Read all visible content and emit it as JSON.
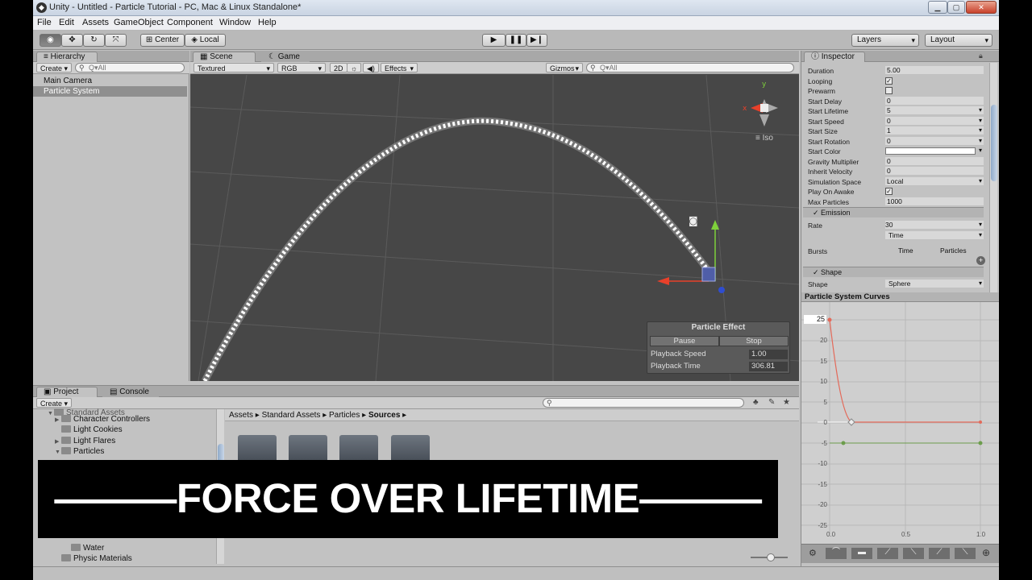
{
  "window": {
    "title": "Unity - Untitled - Particle Tutorial - PC, Mac & Linux Standalone*"
  },
  "menu": [
    "File",
    "Edit",
    "Assets",
    "GameObject",
    "Component",
    "Window",
    "Help"
  ],
  "toolbar": {
    "pivot": "Center",
    "space": "Local",
    "layers": "Layers",
    "layout": "Layout"
  },
  "hierarchy": {
    "tab": "Hierarchy",
    "create": "Create",
    "search": "Q▾All",
    "items": [
      "Main Camera",
      "Particle System"
    ]
  },
  "scene": {
    "tabs": [
      "Scene",
      "Game"
    ],
    "render_mode": "Textured",
    "color_mode": "RGB",
    "mode_2d": "2D",
    "effects": "Effects",
    "gizmos": "Gizmos",
    "search": "Q▾All",
    "projection": "Iso",
    "particle_effect": {
      "title": "Particle Effect",
      "pause": "Pause",
      "stop": "Stop",
      "speed_label": "Playback Speed",
      "speed_value": "1.00",
      "time_label": "Playback Time",
      "time_value": "306.81"
    }
  },
  "inspector": {
    "tab": "Inspector",
    "props": [
      {
        "label": "Duration",
        "value": "5.00"
      },
      {
        "label": "Looping",
        "check": true
      },
      {
        "label": "Prewarm",
        "check": false
      },
      {
        "label": "Start Delay",
        "value": "0"
      },
      {
        "label": "Start Lifetime",
        "value": "5",
        "dd": true
      },
      {
        "label": "Start Speed",
        "value": "0",
        "dd": true
      },
      {
        "label": "Start Size",
        "value": "1",
        "dd": true
      },
      {
        "label": "Start Rotation",
        "value": "0",
        "dd": true
      },
      {
        "label": "Start Color",
        "color": "#ffffff",
        "dd": true
      },
      {
        "label": "Gravity Multiplier",
        "value": "0"
      },
      {
        "label": "Inherit Velocity",
        "value": "0"
      },
      {
        "label": "Simulation Space",
        "value": "Local",
        "dd": true
      },
      {
        "label": "Play On Awake",
        "check": true
      },
      {
        "label": "Max Particles",
        "value": "1000"
      }
    ],
    "emission": {
      "title": "Emission",
      "rate_label": "Rate",
      "rate_value": "30",
      "rate_mode": "Time",
      "bursts_label": "Bursts",
      "col_time": "Time",
      "col_particles": "Particles"
    },
    "shape": {
      "title": "Shape",
      "label": "Shape",
      "value": "Sphere"
    }
  },
  "curves": {
    "title": "Particle System Curves",
    "max_label": "25",
    "y_ticks": [
      "20",
      "15",
      "10",
      "5",
      "0",
      "-5",
      "-10",
      "-15",
      "-20",
      "-25"
    ],
    "x_ticks": [
      "0.0",
      "0.5",
      "1.0"
    ]
  },
  "project": {
    "tabs": [
      "Project",
      "Console"
    ],
    "create": "Create",
    "tree": [
      "Standard Assets",
      "Character Controllers",
      "Light Cookies",
      "Light Flares",
      "Particles",
      "Water",
      "Physic Materials"
    ],
    "breadcrumb": [
      "Assets",
      "Standard Assets",
      "Particles",
      "Sources"
    ]
  },
  "banner": {
    "text": "———FORCE OVER LIFETIME———"
  }
}
